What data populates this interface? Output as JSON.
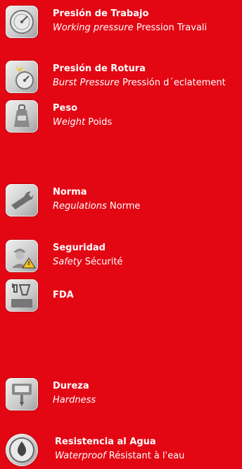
{
  "items": [
    {
      "icon": "pressure-gauge-icon",
      "title": "Presión de Trabajo",
      "en": "Working pressure",
      "fr": "Pression Travali"
    },
    {
      "icon": "burst-gauge-icon",
      "title": "Presión de Rotura",
      "en": "Burst Pressure",
      "fr": "Pressión d´eclatement"
    },
    {
      "icon": "weight-icon",
      "title": "Peso",
      "en": "Weight",
      "fr": "Poids"
    },
    {
      "icon": "wrench-icon",
      "title": "Norma",
      "en": "Regulations",
      "fr": "Norme"
    },
    {
      "icon": "safety-worker-icon",
      "title": "Seguridad",
      "en": "Safety",
      "fr": "Sécurité"
    },
    {
      "icon": "fda-icon",
      "title": "FDA",
      "en": "",
      "fr": ""
    },
    {
      "icon": "hardness-tester-icon",
      "title": "Dureza",
      "en": "Hardness",
      "fr": "Dureté"
    },
    {
      "icon": "water-drop-icon",
      "title": "Resistencia al Agua",
      "en": "Waterproof",
      "fr": "Résistant à l'eau"
    }
  ],
  "colors": {
    "background": "#e30613",
    "text": "#ffffff",
    "icon_bg": "#d6d6d6"
  }
}
